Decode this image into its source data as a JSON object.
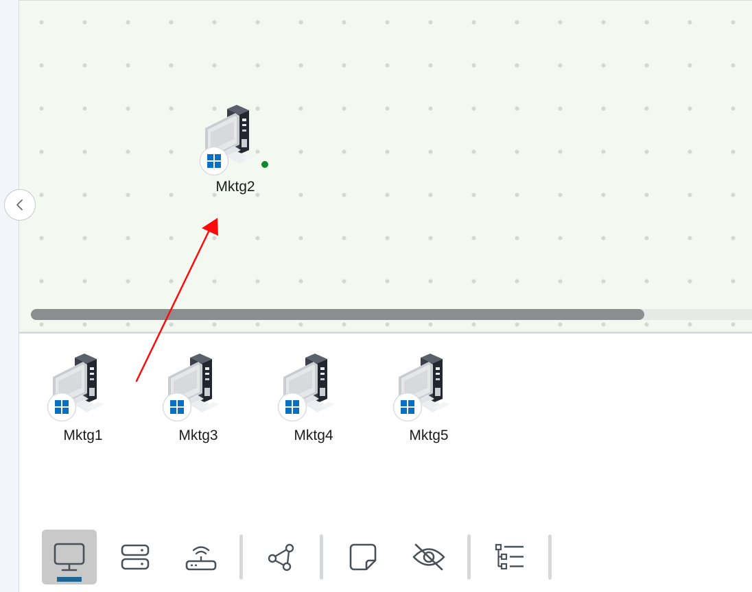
{
  "canvas": {
    "device": {
      "name": "Mktg2",
      "os_icon": "windows-logo-icon",
      "status": "online"
    }
  },
  "tray": {
    "devices": [
      {
        "name": "Mktg1",
        "os_icon": "windows-logo-icon"
      },
      {
        "name": "Mktg3",
        "os_icon": "windows-logo-icon"
      },
      {
        "name": "Mktg4",
        "os_icon": "windows-logo-icon"
      },
      {
        "name": "Mktg5",
        "os_icon": "windows-logo-icon"
      }
    ]
  },
  "toolbar": {
    "tools": [
      {
        "icon": "monitor-icon",
        "active": true
      },
      {
        "icon": "server-icon",
        "active": false
      },
      {
        "icon": "router-icon",
        "active": false
      },
      {
        "icon": "connection-icon",
        "active": false
      },
      {
        "icon": "note-icon",
        "active": false
      },
      {
        "icon": "eye-off-icon",
        "active": false
      },
      {
        "icon": "tree-list-icon",
        "active": false
      }
    ]
  },
  "colors": {
    "canvas_bg": "#f3f8f1",
    "status_online": "#0e8a2b",
    "active_indicator": "#1f6694",
    "annotation_arrow": "#ff0a0a",
    "windows_blue": "#0a6fc2"
  }
}
